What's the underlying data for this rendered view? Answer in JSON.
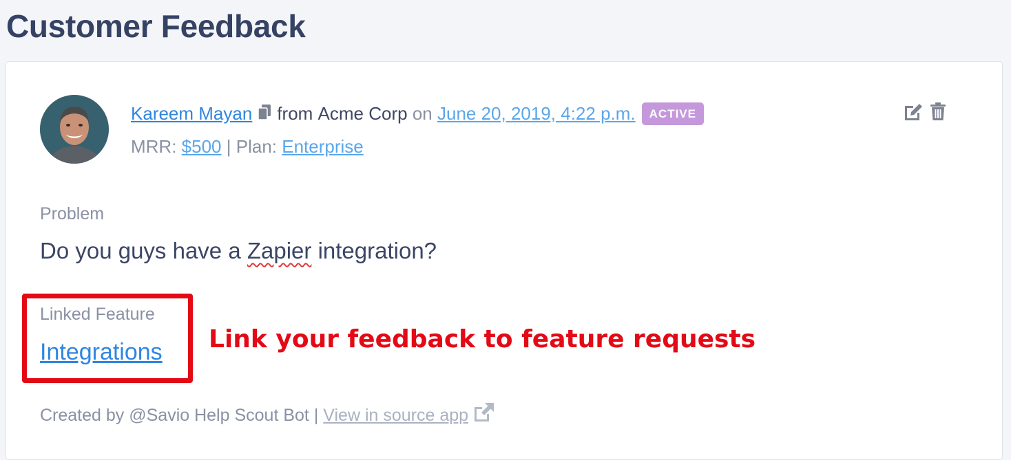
{
  "page": {
    "title": "Customer Feedback"
  },
  "feedback": {
    "customer_name": "Kareem Mayan",
    "from_text": "from",
    "company": "Acme Corp",
    "on_text": "on",
    "date": "June 20, 2019, 4:22 p.m.",
    "status": "ACTIVE",
    "mrr_label": "MRR:",
    "mrr_value": "$500",
    "separator": "|",
    "plan_label": "Plan:",
    "plan_value": "Enterprise",
    "problem_label": "Problem",
    "problem_prefix": "Do you guys have a",
    "problem_highlight": "Zapier",
    "problem_suffix": "integration?",
    "linked_feature_label": "Linked Feature",
    "linked_feature": "Integrations",
    "created_by": "Created by @Savio Help Scout Bot",
    "source_link": "View in source app"
  },
  "annotation": {
    "text": "Link your feedback to feature requests"
  },
  "icons": {
    "copy": "copy-icon",
    "edit": "edit-icon",
    "delete": "trash-icon",
    "external": "external-link-icon"
  },
  "colors": {
    "title": "#364264",
    "link": "#5aa6ec",
    "badge": "#c598dc",
    "annotation": "#e30a16",
    "muted": "#8a91a3"
  }
}
